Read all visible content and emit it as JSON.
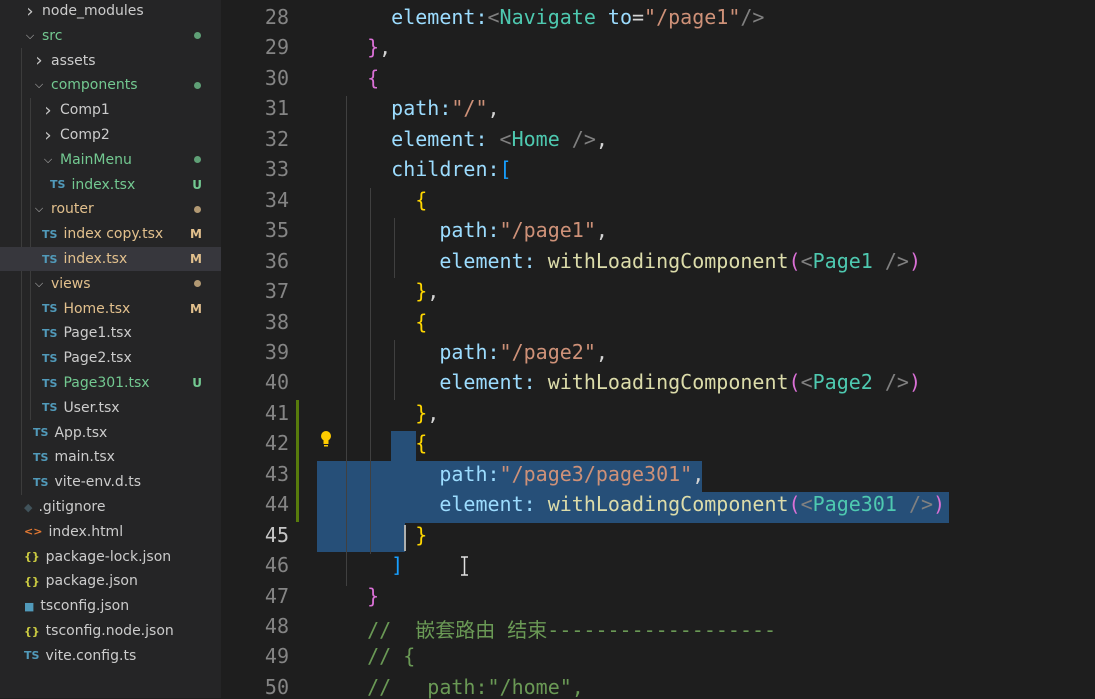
{
  "explorer": {
    "items": [
      {
        "name": "node_modules",
        "kind": "folder",
        "open": false,
        "status": "",
        "dot": "",
        "color": "#cccccc",
        "icon": ""
      },
      {
        "name": "src",
        "kind": "folder",
        "open": true,
        "status": "",
        "dot": "#73c991",
        "color": "#73c991",
        "icon": ""
      },
      {
        "name": "assets",
        "kind": "folder",
        "open": false,
        "status": "",
        "dot": "",
        "color": "#cccccc",
        "icon": ""
      },
      {
        "name": "components",
        "kind": "folder",
        "open": true,
        "status": "",
        "dot": "#73c991",
        "color": "#73c991",
        "icon": ""
      },
      {
        "name": "Comp1",
        "kind": "folder",
        "open": false,
        "status": "",
        "dot": "",
        "color": "#cccccc",
        "icon": ""
      },
      {
        "name": "Comp2",
        "kind": "folder",
        "open": false,
        "status": "",
        "dot": "",
        "color": "#cccccc",
        "icon": ""
      },
      {
        "name": "MainMenu",
        "kind": "folder",
        "open": true,
        "status": "",
        "dot": "#73c991",
        "color": "#73c991",
        "icon": ""
      },
      {
        "name": "index.tsx",
        "kind": "file",
        "open": false,
        "status": "U",
        "dot": "",
        "color": "#73c991",
        "icon": "TS"
      },
      {
        "name": "router",
        "kind": "folder",
        "open": true,
        "status": "",
        "dot": "#e2c08d",
        "color": "#e2c08d",
        "icon": ""
      },
      {
        "name": "index copy.tsx",
        "kind": "file",
        "open": false,
        "status": "M",
        "dot": "",
        "color": "#e2c08d",
        "icon": "TS"
      },
      {
        "name": "index.tsx",
        "kind": "file",
        "open": false,
        "status": "M",
        "dot": "",
        "color": "#e2c08d",
        "icon": "TS",
        "selected": true
      },
      {
        "name": "views",
        "kind": "folder",
        "open": true,
        "status": "",
        "dot": "#e2c08d",
        "color": "#e2c08d",
        "icon": ""
      },
      {
        "name": "Home.tsx",
        "kind": "file",
        "open": false,
        "status": "M",
        "dot": "",
        "color": "#e2c08d",
        "icon": "TS"
      },
      {
        "name": "Page1.tsx",
        "kind": "file",
        "open": false,
        "status": "",
        "dot": "",
        "color": "#cccccc",
        "icon": "TS"
      },
      {
        "name": "Page2.tsx",
        "kind": "file",
        "open": false,
        "status": "",
        "dot": "",
        "color": "#cccccc",
        "icon": "TS"
      },
      {
        "name": "Page301.tsx",
        "kind": "file",
        "open": false,
        "status": "U",
        "dot": "",
        "color": "#73c991",
        "icon": "TS"
      },
      {
        "name": "User.tsx",
        "kind": "file",
        "open": false,
        "status": "",
        "dot": "",
        "color": "#cccccc",
        "icon": "TS"
      },
      {
        "name": "App.tsx",
        "kind": "file",
        "open": false,
        "status": "",
        "dot": "",
        "color": "#cccccc",
        "icon": "TS"
      },
      {
        "name": "main.tsx",
        "kind": "file",
        "open": false,
        "status": "",
        "dot": "",
        "color": "#cccccc",
        "icon": "TS"
      },
      {
        "name": "vite-env.d.ts",
        "kind": "file",
        "open": false,
        "status": "",
        "dot": "",
        "color": "#cccccc",
        "icon": "TS"
      },
      {
        "name": ".gitignore",
        "kind": "file",
        "open": false,
        "status": "",
        "dot": "",
        "color": "#cccccc",
        "icon": "gitignore"
      },
      {
        "name": "index.html",
        "kind": "file",
        "open": false,
        "status": "",
        "dot": "",
        "color": "#cccccc",
        "icon": "html"
      },
      {
        "name": "package-lock.json",
        "kind": "file",
        "open": false,
        "status": "",
        "dot": "",
        "color": "#cccccc",
        "icon": "json"
      },
      {
        "name": "package.json",
        "kind": "file",
        "open": false,
        "status": "",
        "dot": "",
        "color": "#cccccc",
        "icon": "json"
      },
      {
        "name": "tsconfig.json",
        "kind": "file",
        "open": false,
        "status": "",
        "dot": "",
        "color": "#cccccc",
        "icon": "tsconfig"
      },
      {
        "name": "tsconfig.node.json",
        "kind": "file",
        "open": false,
        "status": "",
        "dot": "",
        "color": "#cccccc",
        "icon": "json"
      },
      {
        "name": "vite.config.ts",
        "kind": "file",
        "open": false,
        "status": "",
        "dot": "",
        "color": "#cccccc",
        "icon": "TS"
      }
    ]
  },
  "editor": {
    "active_line": 45,
    "lines": [
      {
        "n": 28,
        "t": [
          {
            "s": "    element:",
            "c": "#9cdcfe"
          },
          {
            "s": "<",
            "c": "#808080"
          },
          {
            "s": "Navigate",
            "c": "#4ec9b0"
          },
          {
            "s": " to",
            "c": "#9cdcfe"
          },
          {
            "s": "=",
            "c": "#d4d4d4"
          },
          {
            "s": "\"/page1\"",
            "c": "#ce9178"
          },
          {
            "s": "/>",
            "c": "#808080"
          }
        ]
      },
      {
        "n": 29,
        "t": [
          {
            "s": "  }",
            "c": "#da70d6"
          },
          {
            "s": ",",
            "c": "#d4d4d4"
          }
        ]
      },
      {
        "n": 30,
        "t": [
          {
            "s": "  {",
            "c": "#da70d6"
          }
        ]
      },
      {
        "n": 31,
        "t": [
          {
            "s": "    path:",
            "c": "#9cdcfe"
          },
          {
            "s": "\"/\"",
            "c": "#ce9178"
          },
          {
            "s": ",",
            "c": "#d4d4d4"
          }
        ]
      },
      {
        "n": 32,
        "t": [
          {
            "s": "    element: ",
            "c": "#9cdcfe"
          },
          {
            "s": "<",
            "c": "#808080"
          },
          {
            "s": "Home",
            "c": "#4ec9b0"
          },
          {
            "s": " />",
            "c": "#808080"
          },
          {
            "s": ",",
            "c": "#d4d4d4"
          }
        ]
      },
      {
        "n": 33,
        "t": [
          {
            "s": "    children:",
            "c": "#9cdcfe"
          },
          {
            "s": "[",
            "c": "#179fff"
          }
        ]
      },
      {
        "n": 34,
        "t": [
          {
            "s": "      {",
            "c": "#ffd700"
          }
        ]
      },
      {
        "n": 35,
        "t": [
          {
            "s": "        path:",
            "c": "#9cdcfe"
          },
          {
            "s": "\"/page1\"",
            "c": "#ce9178"
          },
          {
            "s": ",",
            "c": "#d4d4d4"
          }
        ]
      },
      {
        "n": 36,
        "t": [
          {
            "s": "        element: ",
            "c": "#9cdcfe"
          },
          {
            "s": "withLoadingComponent",
            "c": "#dcdcaa"
          },
          {
            "s": "(",
            "c": "#da70d6"
          },
          {
            "s": "<",
            "c": "#808080"
          },
          {
            "s": "Page1",
            "c": "#4ec9b0"
          },
          {
            "s": " />",
            "c": "#808080"
          },
          {
            "s": ")",
            "c": "#da70d6"
          }
        ]
      },
      {
        "n": 37,
        "t": [
          {
            "s": "      }",
            "c": "#ffd700"
          },
          {
            "s": ",",
            "c": "#d4d4d4"
          }
        ]
      },
      {
        "n": 38,
        "t": [
          {
            "s": "      {",
            "c": "#ffd700"
          }
        ]
      },
      {
        "n": 39,
        "t": [
          {
            "s": "        path:",
            "c": "#9cdcfe"
          },
          {
            "s": "\"/page2\"",
            "c": "#ce9178"
          },
          {
            "s": ",",
            "c": "#d4d4d4"
          }
        ]
      },
      {
        "n": 40,
        "t": [
          {
            "s": "        element: ",
            "c": "#9cdcfe"
          },
          {
            "s": "withLoadingComponent",
            "c": "#dcdcaa"
          },
          {
            "s": "(",
            "c": "#da70d6"
          },
          {
            "s": "<",
            "c": "#808080"
          },
          {
            "s": "Page2",
            "c": "#4ec9b0"
          },
          {
            "s": " />",
            "c": "#808080"
          },
          {
            "s": ")",
            "c": "#da70d6"
          }
        ]
      },
      {
        "n": 41,
        "t": [
          {
            "s": "      }",
            "c": "#ffd700"
          },
          {
            "s": ",",
            "c": "#d4d4d4"
          }
        ]
      },
      {
        "n": 42,
        "t": [
          {
            "s": "      {",
            "c": "#ffd700"
          }
        ]
      },
      {
        "n": 43,
        "t": [
          {
            "s": "        path:",
            "c": "#9cdcfe"
          },
          {
            "s": "\"/page3/page301\"",
            "c": "#ce9178"
          },
          {
            "s": ",",
            "c": "#d4d4d4"
          }
        ]
      },
      {
        "n": 44,
        "t": [
          {
            "s": "        element: ",
            "c": "#9cdcfe"
          },
          {
            "s": "withLoadingComponent",
            "c": "#dcdcaa"
          },
          {
            "s": "(",
            "c": "#da70d6"
          },
          {
            "s": "<",
            "c": "#808080"
          },
          {
            "s": "Page301",
            "c": "#4ec9b0"
          },
          {
            "s": " />",
            "c": "#808080"
          },
          {
            "s": ")",
            "c": "#da70d6"
          }
        ]
      },
      {
        "n": 45,
        "t": [
          {
            "s": "      }",
            "c": "#ffd700"
          }
        ]
      },
      {
        "n": 46,
        "t": [
          {
            "s": "    ]",
            "c": "#179fff"
          }
        ]
      },
      {
        "n": 47,
        "t": [
          {
            "s": "  }",
            "c": "#da70d6"
          }
        ]
      },
      {
        "n": 48,
        "t": [
          {
            "s": "  //  嵌套路由 结束-------------------",
            "c": "#6a9955"
          }
        ]
      },
      {
        "n": 49,
        "t": [
          {
            "s": "  // {",
            "c": "#6a9955"
          }
        ]
      },
      {
        "n": 50,
        "t": [
          {
            "s": "  //   path:\"/home\",",
            "c": "#6a9955"
          }
        ]
      }
    ]
  }
}
